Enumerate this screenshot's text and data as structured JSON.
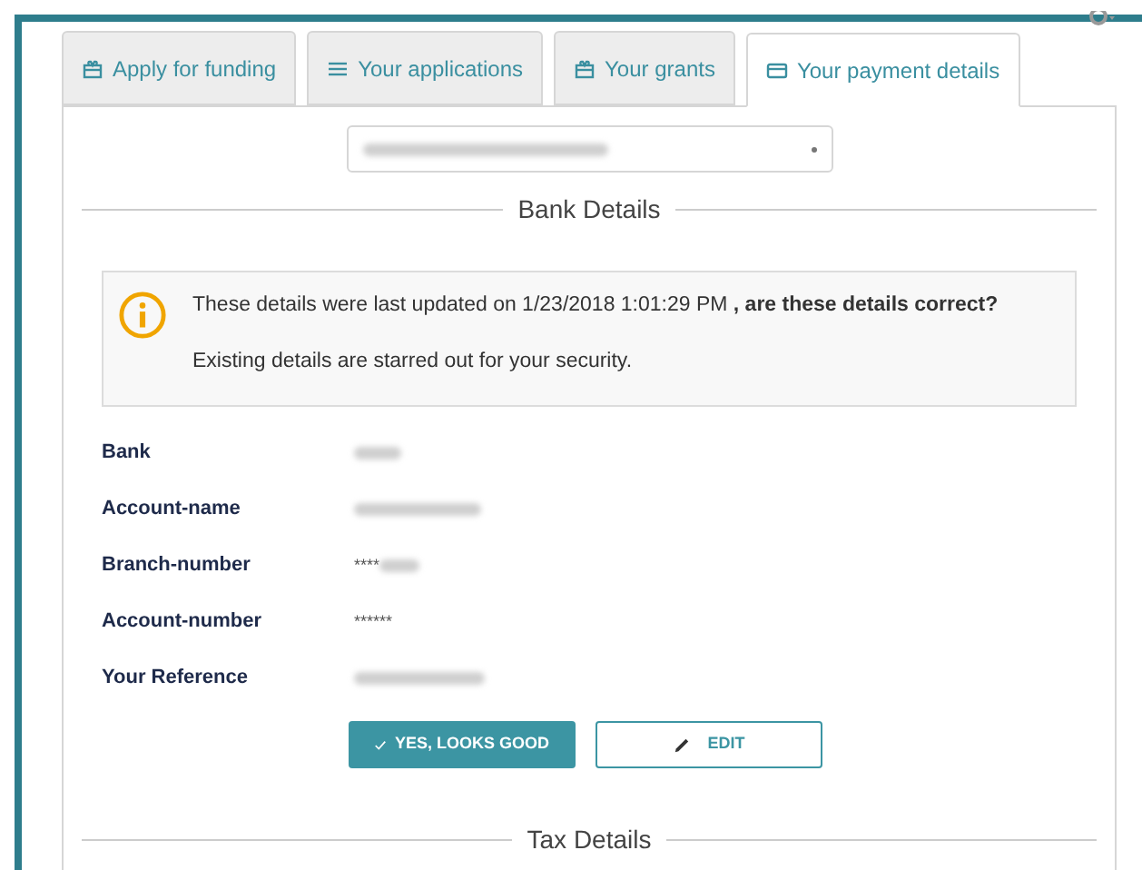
{
  "tabs": [
    {
      "label": "Apply for funding",
      "kind": "gift",
      "selected": false
    },
    {
      "label": "Your applications",
      "kind": "list",
      "selected": false
    },
    {
      "label": "Your grants",
      "kind": "gift",
      "selected": false
    },
    {
      "label": "Your payment details",
      "kind": "card",
      "selected": true
    }
  ],
  "bank_section": {
    "title": "Bank Details",
    "alert": {
      "message": "These details were last updated on 1/23/2018 1:01:29 PM **, are these details correct?**",
      "note": "Existing details are starred out for your security."
    },
    "fields": [
      {
        "label": "Bank",
        "redacted": true
      },
      {
        "label": "Account-name",
        "redacted": true
      },
      {
        "label": "Branch-number",
        "visible": "****",
        "redacted": true
      },
      {
        "label": "Account-number",
        "visible": "******",
        "redacted": false
      },
      {
        "label": "Your Reference",
        "redacted": true
      }
    ],
    "buttons": [
      {
        "kind": "primary",
        "label": "YES, LOOKS GOOD"
      },
      {
        "kind": "secondary",
        "label": "EDIT"
      }
    ]
  },
  "tax_section": {
    "title": "Tax Details"
  }
}
